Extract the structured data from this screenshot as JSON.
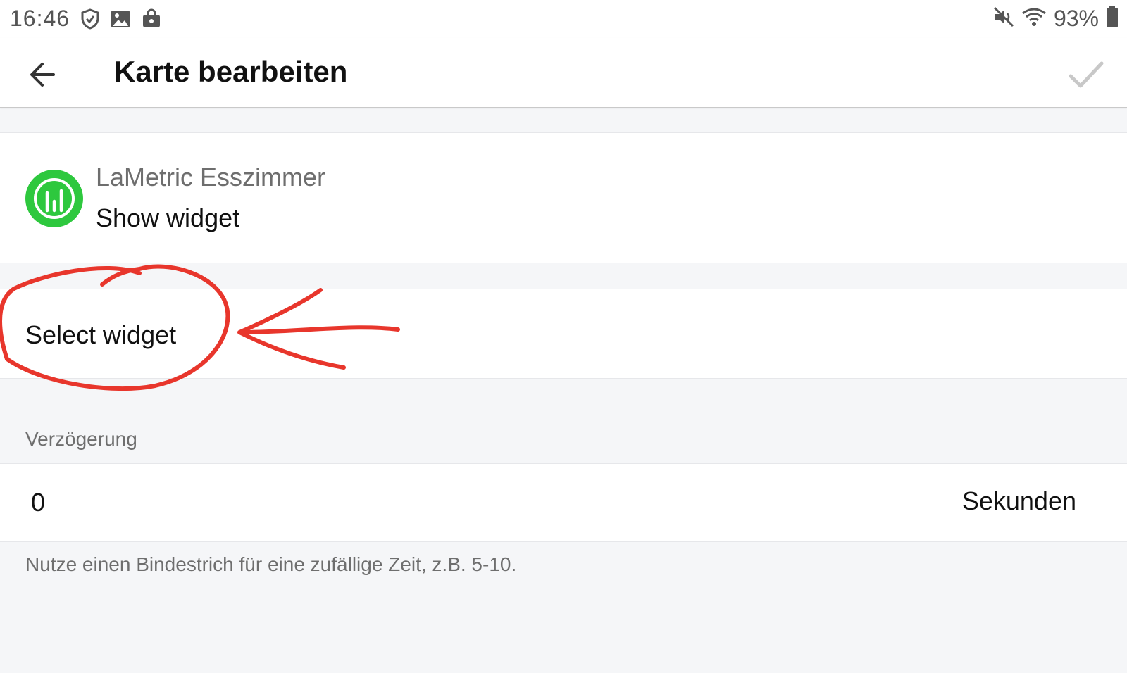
{
  "status_bar": {
    "time": "16:46",
    "battery_percent": "93%",
    "left_icons": [
      "shield-icon",
      "image-icon",
      "shopping-bag-icon"
    ],
    "right_icons": [
      "mute-icon",
      "wifi-icon",
      "battery-icon"
    ]
  },
  "app_bar": {
    "title": "Karte bearbeiten",
    "back_icon": "arrow-left-icon",
    "confirm_icon": "check-icon"
  },
  "device_card": {
    "device_name": "LaMetric Esszimmer",
    "action": "Show widget",
    "icon": "lametric-icon",
    "icon_color": "#2ec83e"
  },
  "select_card": {
    "label": "Select widget"
  },
  "delay": {
    "section_label": "Verzögerung",
    "value": "0",
    "unit": "Sekunden",
    "hint": "Nutze einen Bindestrich für eine zufällige Zeit, z.B. 5-10."
  },
  "colors": {
    "annotation": "#e8362c",
    "background": "#f5f6f8"
  }
}
